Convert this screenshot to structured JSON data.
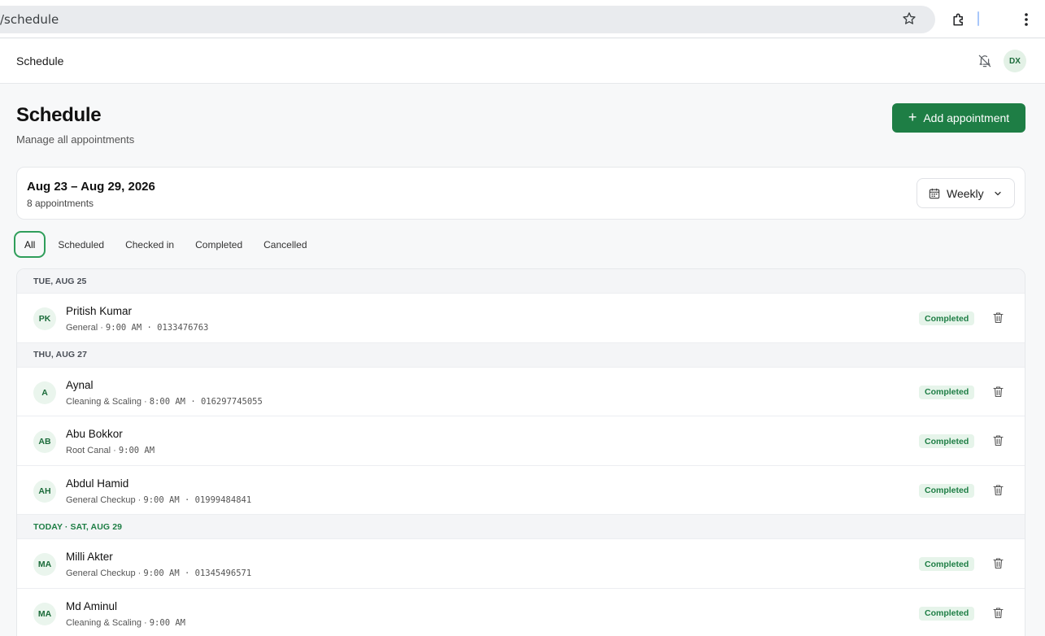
{
  "browser": {
    "url": "/schedule"
  },
  "appbar": {
    "title": "Schedule",
    "avatar": "DX"
  },
  "page": {
    "title": "Schedule",
    "subtitle": "Manage all appointments",
    "add_button": "Add appointment",
    "add_icon": "+"
  },
  "range": {
    "title": "Aug 23 – Aug 29, 2026",
    "count": "8 appointments",
    "view_select": "Weekly"
  },
  "tabs": [
    {
      "label": "All",
      "active": true
    },
    {
      "label": "Scheduled"
    },
    {
      "label": "Checked in"
    },
    {
      "label": "Completed"
    },
    {
      "label": "Cancelled"
    }
  ],
  "groups": [
    {
      "header": "TUE, AUG 25",
      "today": false,
      "items": [
        {
          "initials": "PK",
          "name": "Pritish Kumar",
          "service": "General · ",
          "time": "9:00 AM",
          "phone": " · 0133476763",
          "status": "Completed"
        }
      ]
    },
    {
      "header": "THU, AUG 27",
      "today": false,
      "items": [
        {
          "initials": "A",
          "name": "Aynal",
          "service": "Cleaning & Scaling · ",
          "time": "8:00 AM",
          "phone": " · 016297745055",
          "status": "Completed"
        },
        {
          "initials": "AB",
          "name": "Abu Bokkor",
          "service": "Root Canal · ",
          "time": "9:00 AM",
          "phone": "",
          "status": "Completed"
        },
        {
          "initials": "AH",
          "name": "Abdul Hamid",
          "service": "General Checkup · ",
          "time": "9:00 AM",
          "phone": " · 01999484841",
          "status": "Completed"
        }
      ]
    },
    {
      "header": "TODAY · SAT, AUG 29",
      "today": true,
      "items": [
        {
          "initials": "MA",
          "name": "Milli Akter",
          "service": "General Checkup · ",
          "time": "9:00 AM",
          "phone": " · 01345496571",
          "status": "Completed"
        },
        {
          "initials": "MA",
          "name": "Md Aminul",
          "service": "Cleaning & Scaling · ",
          "time": "9:00 AM",
          "phone": "",
          "status": "Completed"
        }
      ]
    }
  ],
  "colors": {
    "accent": "#1e7e45",
    "status_bg": "#e6f4ea",
    "today_header": "#1e7e45"
  }
}
